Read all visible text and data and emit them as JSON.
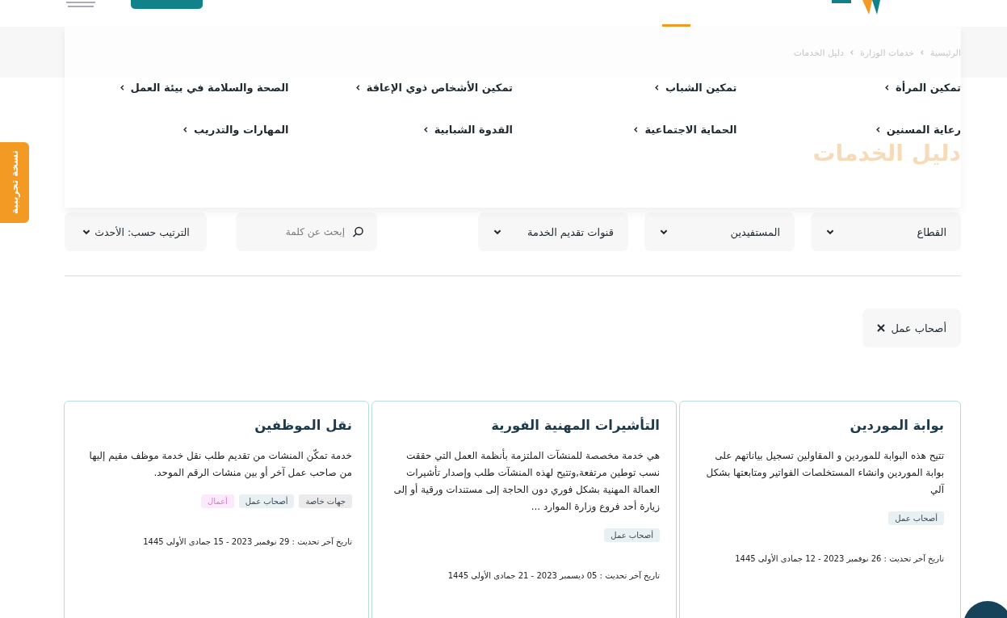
{
  "breadcrumb": [
    "الرئيسية",
    "خدمات الوزارة",
    "دليل الخدمات"
  ],
  "page_title": "دليل الخدمات",
  "mega_menu": [
    {
      "label": "تمكين المرأة"
    },
    {
      "label": "تمكين الشباب"
    },
    {
      "label": "تمكين الأشخاص ذوي الإعاقة"
    },
    {
      "label": "الصحة والسلامة في بيئة العمل"
    },
    {
      "label": "رعاية المسنين"
    },
    {
      "label": "الحماية الاجتماعية"
    },
    {
      "label": "القدوة الشبابية"
    },
    {
      "label": "المهارات والتدريب"
    }
  ],
  "filters": [
    {
      "label": "القطاع"
    },
    {
      "label": "المستفيدين"
    },
    {
      "label": "قنوات تقديم الخدمة"
    }
  ],
  "search": {
    "placeholder": "إبحث عن كلمة"
  },
  "sort": {
    "label": "الترتيب حسب: الأحدث"
  },
  "active_filters": [
    {
      "label": "أصحاب عمل"
    }
  ],
  "cards": [
    {
      "title": "بوابة الموردين",
      "description": "تتيح هذه البوابة للموردين و المقاولين تسجيل بياناتهم على بوابة الموردين وانشاء المستخلصات الفواتير ومتابعتها بشكل آلي",
      "tags": [
        {
          "label": "أصحاب عمل",
          "color": "#e9f0f4"
        }
      ],
      "updated": "تاريخ آخر تحديث : 26 نوفمبر 2023 - 12 جمادى الأولى 1445"
    },
    {
      "title": "التأشيرات المهنية الفورية",
      "description": "هي خدمة مخصصة للمنشآت الملتزمة بأنظمة العمل التي حققت نسب توطين مرتفعة,وتتيح لهذه المنشآت طلب وإصدار تأشيرات العمالة المهنية بشكل فوري دون الحاجة إلى مستندات ورقية أو إلى زيارة أحد فروع وزارة الموارد ...",
      "tags": [
        {
          "label": "أصحاب عمل",
          "color": "#e9f0f4"
        }
      ],
      "updated": "تاريخ آخر تحديث : 05 ديسمبر 2023 - 21 جمادى الأولى 1445"
    },
    {
      "title": "نقل الموظفين",
      "description": "خدمة تمكّن المنشات من تقديم طلب نقل خدمة موظف مقيم إليها من صاحب عمل آخر أو بين منشات الرقم الموحد.",
      "tags": [
        {
          "label": "جهات خاصة",
          "color": "#ebebeb"
        },
        {
          "label": "أصحاب عمل",
          "color": "#e9f0f4"
        },
        {
          "label": "أعمال",
          "color": "#fce9fb"
        }
      ],
      "updated": "تاريخ آخر تحديث : 29 نوفمبر 2023 - 15 جمادى الأولى 1445"
    }
  ],
  "side_tab": {
    "label": "نسخة تجريبية"
  }
}
